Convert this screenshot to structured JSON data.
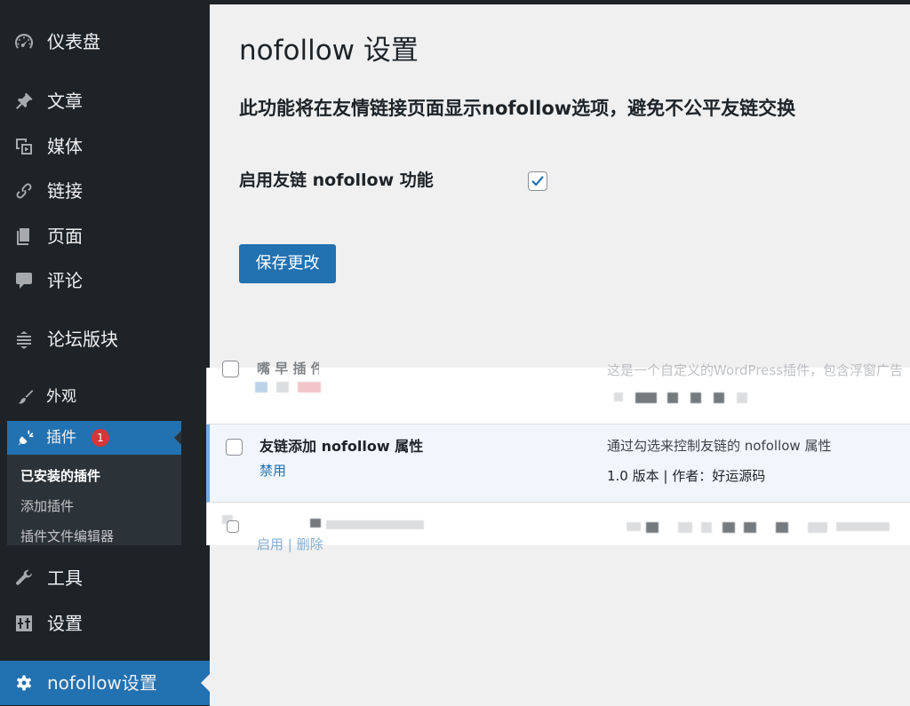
{
  "sidebar": {
    "items": [
      {
        "label": "仪表盘",
        "icon": "dashboard-icon"
      },
      {
        "label": "文章",
        "icon": "pin-icon"
      },
      {
        "label": "媒体",
        "icon": "media-icon"
      },
      {
        "label": "链接",
        "icon": "link-icon"
      },
      {
        "label": "页面",
        "icon": "page-icon"
      },
      {
        "label": "评论",
        "icon": "comment-icon"
      },
      {
        "label": "论坛版块",
        "icon": "forum-icon"
      },
      {
        "label": "外观",
        "icon": "brush-icon"
      },
      {
        "label": "插件",
        "icon": "plugin-icon",
        "badge": "1"
      },
      {
        "label": "工具",
        "icon": "wrench-icon"
      },
      {
        "label": "设置",
        "icon": "settings-sliders-icon"
      },
      {
        "label": "nofollow设置",
        "icon": "gear-icon"
      }
    ],
    "submenu": [
      "已安装的插件",
      "添加插件",
      "插件文件编辑器"
    ],
    "active_color": "#2271b1",
    "bg_color": "#1d2327"
  },
  "main": {
    "title": "nofollow 设置",
    "description": "此功能将在友情链接页面显示nofollow选项，避免不公平友链交换",
    "field_label": "启用友链 nofollow 功能",
    "checkbox_checked": true,
    "save_label": "保存更改"
  },
  "plugin_list": {
    "top_row": {
      "name": "嘴 早 插 件",
      "desc": "这是一个自定义的WordPress插件，包含浮窗广告"
    },
    "active_row": {
      "name": "友链添加 nofollow 属性",
      "action": "禁用",
      "desc": "通过勾选来控制友链的 nofollow 属性",
      "meta": "1.0 版本 | 作者：好运源码"
    },
    "bottom_row": {
      "actions": "启用 | 删除"
    }
  }
}
